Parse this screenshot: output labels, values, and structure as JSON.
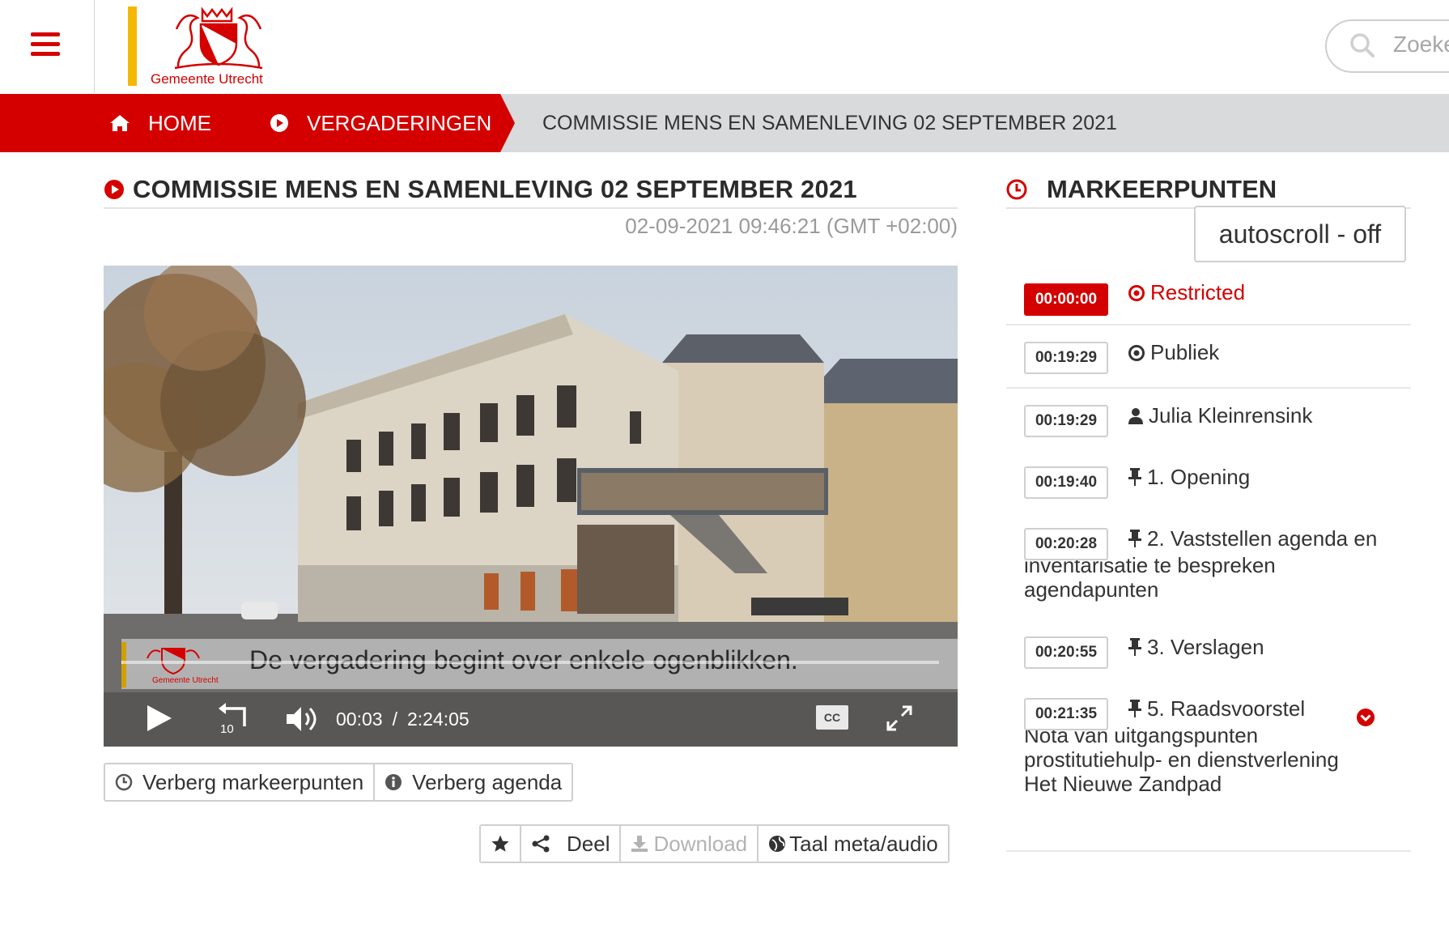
{
  "header": {
    "logo_text": "Gemeente Utrecht",
    "search_placeholder": "Zoeken"
  },
  "breadcrumb": {
    "home": "HOME",
    "meetings": "VERGADERINGEN",
    "current": "COMMISSIE MENS EN SAMENLEVING 02 SEPTEMBER 2021"
  },
  "main": {
    "title": "COMMISSIE MENS EN SAMENLEVING 02 SEPTEMBER 2021",
    "datetime": "02-09-2021 09:46:21 (GMT +02:00)"
  },
  "player": {
    "caption": "De vergadering begint over enkele ogenblikken.",
    "overlay_logo_text": "Gemeente Utrecht",
    "current_time": "00:03",
    "duration": "2:24:05",
    "progress_fraction": 0.0003,
    "rewind_seconds": "10",
    "cc_label": "CC"
  },
  "buttons": {
    "hide_markers": "Verberg markeerpunten",
    "hide_agenda": "Verberg agenda",
    "share": "Deel",
    "download": "Download",
    "language": "Taal meta/audio"
  },
  "markers": {
    "title": "MARKEERPUNTEN",
    "autoscroll": "autoscroll - off",
    "items": [
      {
        "time": "00:00:00",
        "label": "Restricted",
        "icon": "dot-circle-icon",
        "active": true
      },
      {
        "time": "00:19:29",
        "label": "Publiek",
        "icon": "dot-circle-icon",
        "active": false
      },
      {
        "time": "00:19:29",
        "label": "Julia Kleinrensink",
        "icon": "user-icon",
        "active": false
      },
      {
        "time": "00:19:40",
        "label": "1. Opening",
        "icon": "pin-icon",
        "active": false
      },
      {
        "time": "00:20:28",
        "label": "2. Vaststellen agenda en inventarisatie te bespreken agendapunten",
        "icon": "pin-icon",
        "active": false
      },
      {
        "time": "00:20:55",
        "label": "3. Verslagen",
        "icon": "pin-icon",
        "active": false
      },
      {
        "time": "00:21:35",
        "label": "5. Raadsvoorstel Nota van uitgangspunten prostitutiehulp- en dienstverlening Het Nieuwe Zandpad",
        "icon": "pin-icon",
        "active": false,
        "expandable": true
      }
    ]
  },
  "colors": {
    "brand_red": "#d40000",
    "logo_yellow": "#f5b800",
    "crumb_grey": "#d9dadc"
  }
}
